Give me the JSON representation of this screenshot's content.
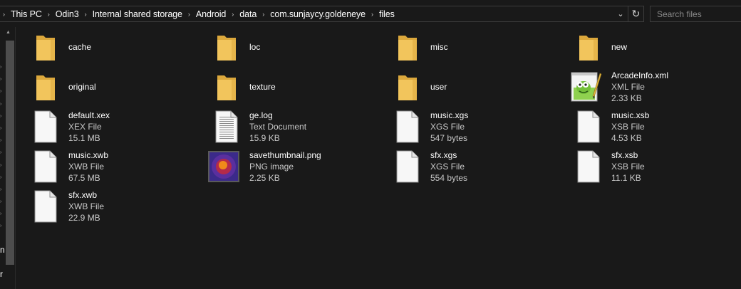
{
  "breadcrumb": [
    "This PC",
    "Odin3",
    "Internal shared storage",
    "Android",
    "data",
    "com.sunjaycy.goldeneye",
    "files"
  ],
  "search": {
    "placeholder": "Search files"
  },
  "nav_peek": [
    "n",
    "r"
  ],
  "rows": [
    [
      {
        "name": "cache",
        "kind": "folder"
      },
      {
        "name": "loc",
        "kind": "folder"
      },
      {
        "name": "misc",
        "kind": "folder"
      },
      {
        "name": "new",
        "kind": "folder"
      }
    ],
    [
      {
        "name": "original",
        "kind": "folder"
      },
      {
        "name": "texture",
        "kind": "folder"
      },
      {
        "name": "user",
        "kind": "folder"
      },
      {
        "name": "ArcadeInfo.xml",
        "type": "XML File",
        "size": "2.33 KB",
        "kind": "xml"
      }
    ],
    [
      {
        "name": "default.xex",
        "type": "XEX File",
        "size": "15.1 MB",
        "kind": "blank"
      },
      {
        "name": "ge.log",
        "type": "Text Document",
        "size": "15.9 KB",
        "kind": "text"
      },
      {
        "name": "music.xgs",
        "type": "XGS File",
        "size": "547 bytes",
        "kind": "blank"
      },
      {
        "name": "music.xsb",
        "type": "XSB File",
        "size": "4.53 KB",
        "kind": "blank"
      }
    ],
    [
      {
        "name": "music.xwb",
        "type": "XWB File",
        "size": "67.5 MB",
        "kind": "blank"
      },
      {
        "name": "savethumbnail.png",
        "type": "PNG image",
        "size": "2.25 KB",
        "kind": "png"
      },
      {
        "name": "sfx.xgs",
        "type": "XGS File",
        "size": "554 bytes",
        "kind": "blank"
      },
      {
        "name": "sfx.xsb",
        "type": "XSB File",
        "size": "11.1 KB",
        "kind": "blank"
      }
    ],
    [
      {
        "name": "sfx.xwb",
        "type": "XWB File",
        "size": "22.9 MB",
        "kind": "blank"
      }
    ]
  ],
  "colors": {
    "background": "#191919",
    "folder": "#f2c55c",
    "folder_dark": "#dca83c",
    "text": "#ffffff",
    "secondary": "#c8c8c8"
  },
  "icons": {
    "folder": "folder-icon",
    "blank": "file-icon",
    "text": "text-document-icon",
    "xml": "notepad-plus-plus-icon",
    "png": "image-thumbnail-icon"
  }
}
